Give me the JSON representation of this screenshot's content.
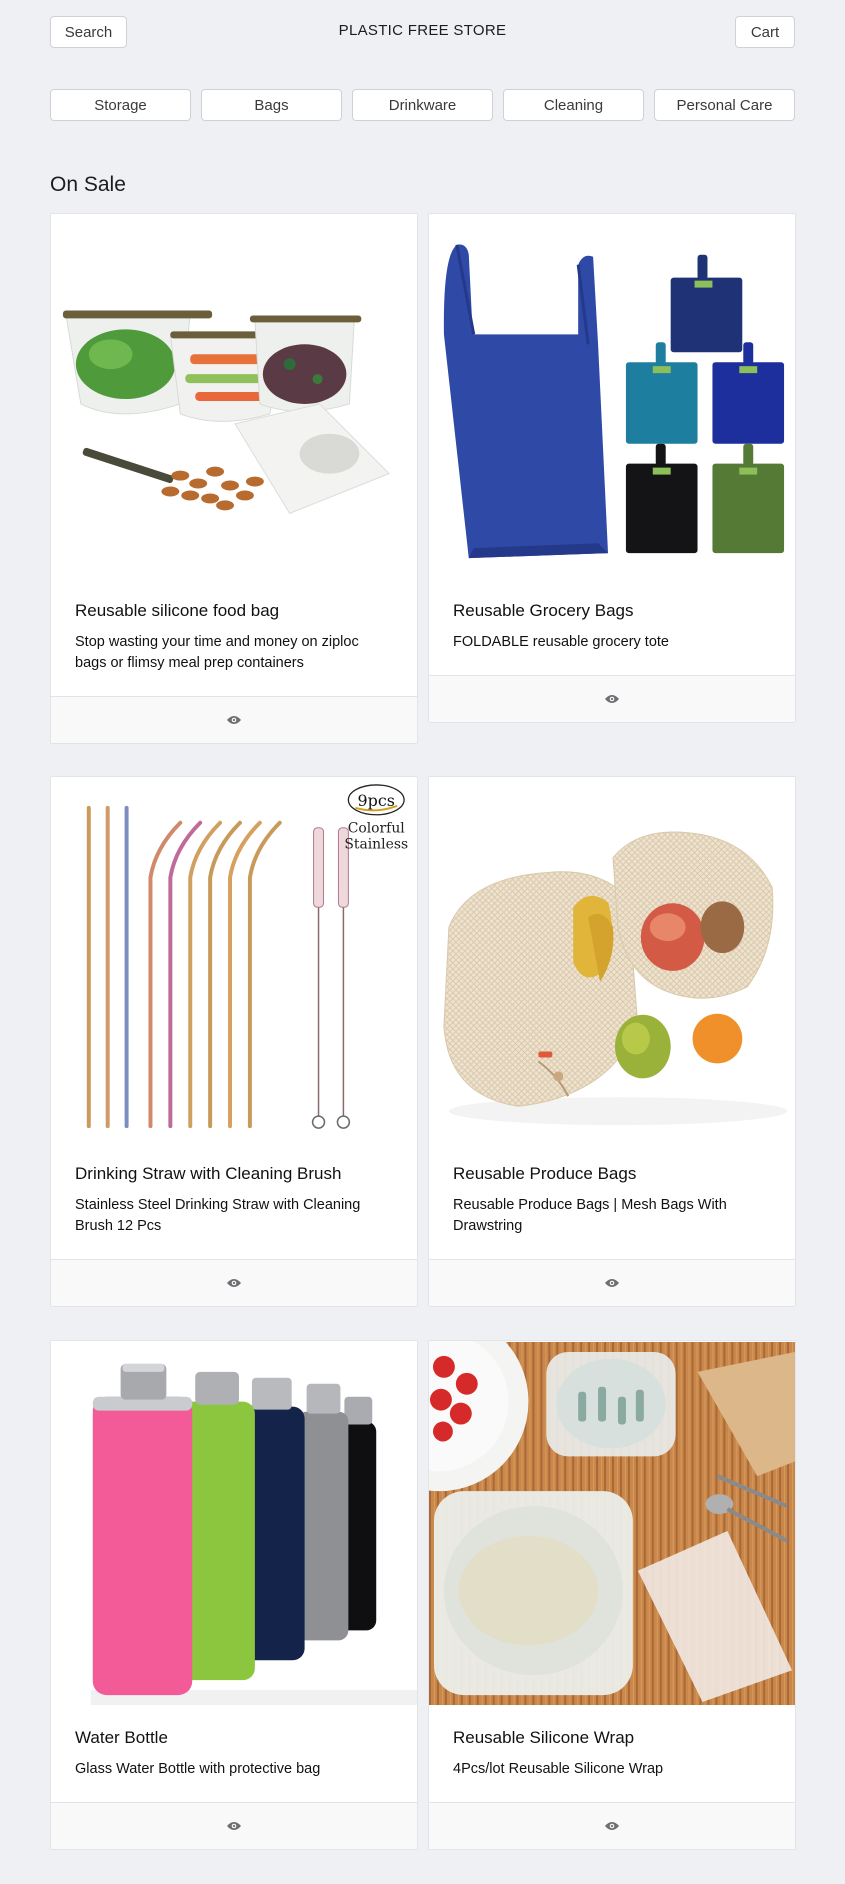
{
  "header": {
    "search_label": "Search",
    "store_title": "PLASTIC FREE STORE",
    "cart_label": "Cart"
  },
  "categories": [
    "Storage",
    "Bags",
    "Drinkware",
    "Cleaning",
    "Personal Care"
  ],
  "section": {
    "title": "On Sale"
  },
  "products": [
    {
      "title": "Reusable silicone food bag",
      "description": "Stop wasting your time and money on ziploc bags or flimsy meal prep containers"
    },
    {
      "title": "Reusable Grocery Bags",
      "description": "FOLDABLE reusable grocery tote"
    },
    {
      "title": "Drinking Straw with Cleaning Brush",
      "description": "Stainless Steel Drinking Straw with Cleaning Brush 12 Pcs",
      "image_text": {
        "badge": "9pcs",
        "line1": "Colorful",
        "line2": "Stainless"
      }
    },
    {
      "title": "Reusable Produce Bags",
      "description": "Reusable Produce Bags | Mesh Bags With Drawstring"
    },
    {
      "title": "Water Bottle",
      "description": "Glass Water Bottle with protective bag"
    },
    {
      "title": "Reusable Silicone Wrap",
      "description": "4Pcs/lot Reusable Silicone Wrap"
    }
  ],
  "icons": {
    "view": "eye-icon"
  }
}
